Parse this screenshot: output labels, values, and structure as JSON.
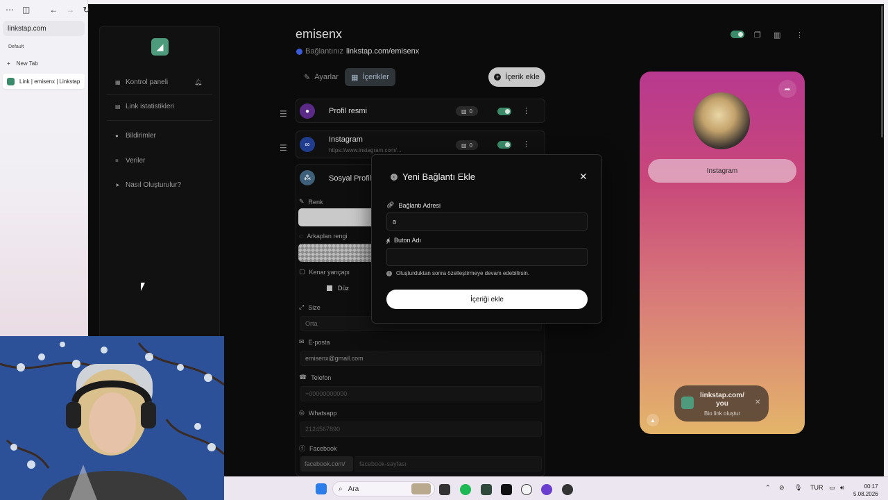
{
  "browser": {
    "url": "linkstap.com",
    "profile": "Default",
    "new_tab_label": "New Tab",
    "active_tab_title": "Link | emisenx | Linkstap",
    "menu_icon": "ellipsis-icon",
    "sidebar_icon": "sidebar-toggle-icon",
    "back_icon": "arrow-left-icon",
    "forward_icon": "arrow-right-icon",
    "refresh_icon": "refresh-icon"
  },
  "sidebar": {
    "items": [
      {
        "label": "Kontrol paneli",
        "icon": "grid-icon"
      },
      {
        "label": "Link istatistikleri",
        "icon": "bar-chart-icon"
      },
      {
        "label": "Bildirimler",
        "icon": "bell-icon"
      },
      {
        "label": "Veriler",
        "icon": "database-icon"
      },
      {
        "label": "Nasıl Oluşturulur?",
        "icon": "rocket-icon"
      }
    ]
  },
  "header": {
    "username": "emisenx",
    "link_prefix": "Bağlantınız",
    "link_url": "linkstap.com/emisenx",
    "tabs": [
      {
        "label": "Ayarlar",
        "icon": "wrench-icon",
        "active": false
      },
      {
        "label": "İçerikler",
        "icon": "grid-icon",
        "active": true
      }
    ],
    "add_content_label": "İçerik ekle"
  },
  "cards": [
    {
      "title": "Profil resmi",
      "count": "0",
      "icon": "user-icon",
      "color": "#5b2a86"
    },
    {
      "title": "Instagram",
      "subtitle": "https://www.instagram.com/...",
      "count": "0",
      "icon": "link-icon",
      "color": "#1f3c8f"
    },
    {
      "title": "Sosyal Profille",
      "icon": "users-icon",
      "color": "#3d5f79"
    }
  ],
  "social_form": {
    "color_label": "Renk",
    "bg_color_label": "Arkaplan rengi",
    "border_radius_label": "Kenar yarıçapı",
    "border_option": "Düz",
    "size_label": "Size",
    "size_value": "Orta",
    "email_label": "E-posta",
    "email_value": "emisenx@gmail.com",
    "phone_label": "Telefon",
    "phone_placeholder": "+00000000000",
    "whatsapp_label": "Whatsapp",
    "whatsapp_placeholder": "2124567890",
    "facebook_label": "Facebook",
    "facebook_prefix": "facebook.com/",
    "facebook_placeholder": "facebook-sayfası"
  },
  "modal": {
    "title": "Yeni Bağlantı Ekle",
    "url_label": "Bağlantı Adresi",
    "url_value": "a",
    "button_name_label": "Buton Adı",
    "button_name_value": "",
    "info_text": "Oluşturduktan sonra özelleştirmeye devam edebilirsin.",
    "submit_label": "İçeriği ekle"
  },
  "preview": {
    "instagram_button": "Instagram",
    "promo_title": "linkstap.com/ you",
    "promo_subtitle": "Bio link oluştur"
  },
  "taskbar": {
    "search_placeholder": "Ara",
    "language": "TUR",
    "time": "00:17",
    "date": "5.08.2026"
  },
  "colors": {
    "accent_green": "#3b8b6a",
    "phone_gradient_top": "#b8398f",
    "phone_gradient_bottom": "#e4b56a"
  }
}
